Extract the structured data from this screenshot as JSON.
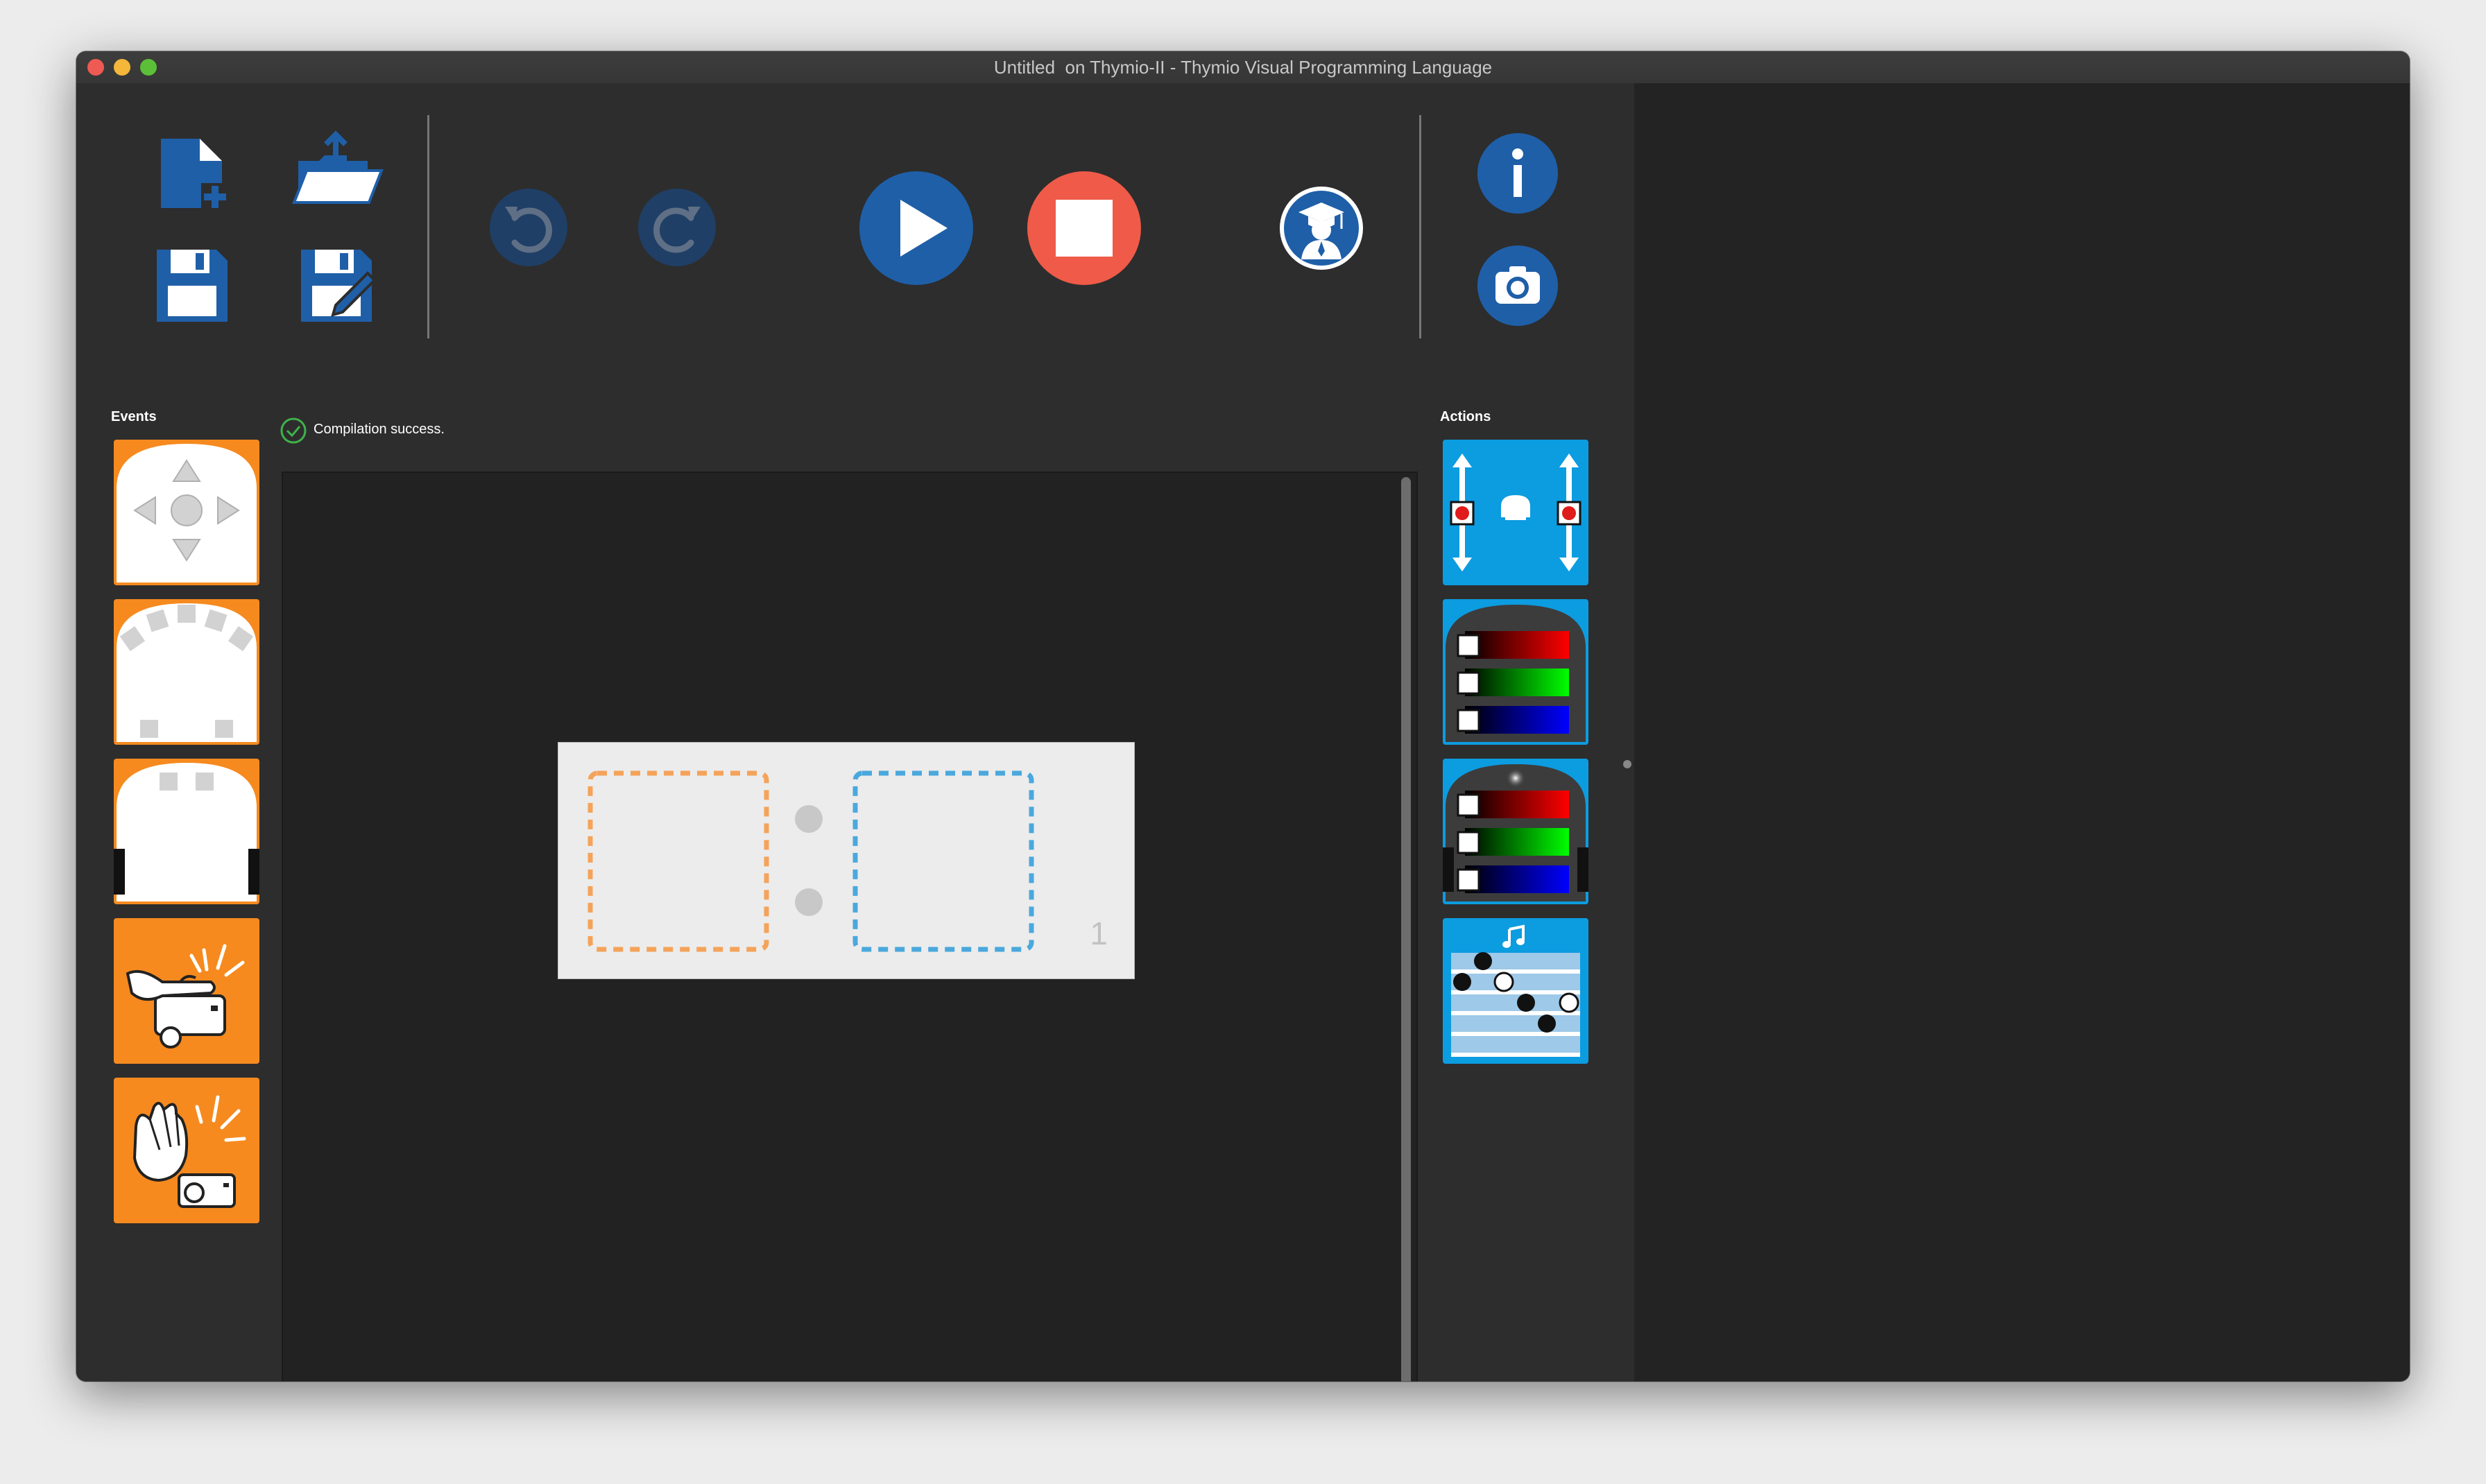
{
  "window": {
    "title": "Untitled  on Thymio-II - Thymio Visual Programming Language",
    "traffic_lights": {
      "close": "#ee5b52",
      "minimize": "#f4b73a",
      "zoom": "#5bc038"
    }
  },
  "toolbar": {
    "buttons": [
      {
        "name": "new-button",
        "icon": "new-file-icon"
      },
      {
        "name": "open-button",
        "icon": "open-folder-icon"
      },
      {
        "name": "save-button",
        "icon": "floppy-disk-icon"
      },
      {
        "name": "save-as-button",
        "icon": "floppy-disk-edit-icon"
      },
      {
        "name": "undo-button",
        "icon": "undo-icon"
      },
      {
        "name": "redo-button",
        "icon": "redo-icon"
      },
      {
        "name": "run-button",
        "icon": "play-icon"
      },
      {
        "name": "stop-button",
        "icon": "stop-icon"
      },
      {
        "name": "advanced-mode-button",
        "icon": "graduate-icon"
      },
      {
        "name": "help-button",
        "icon": "info-icon"
      },
      {
        "name": "screenshot-button",
        "icon": "camera-icon"
      }
    ],
    "colors": {
      "primary": "#1f5fa8",
      "stop": "#ef5b48",
      "disabled": "#1f3f66"
    }
  },
  "events": {
    "label": "Events",
    "tiles": [
      {
        "name": "event-buttons",
        "icon": "arrow-buttons-icon",
        "color": "#f68a1f"
      },
      {
        "name": "event-front-proximity",
        "icon": "front-proximity-icon",
        "color": "#f68a1f"
      },
      {
        "name": "event-ground-sensors",
        "icon": "ground-sensors-icon",
        "color": "#f68a1f"
      },
      {
        "name": "event-tap",
        "icon": "tap-robot-icon",
        "color": "#f68a1f"
      },
      {
        "name": "event-clap",
        "icon": "clap-icon",
        "color": "#f68a1f"
      }
    ]
  },
  "actions": {
    "label": "Actions",
    "tiles": [
      {
        "name": "action-motors",
        "icon": "motors-icon",
        "color": "#0c9ce0"
      },
      {
        "name": "action-top-color",
        "icon": "top-color-icon",
        "color": "#0c9ce0"
      },
      {
        "name": "action-bottom-color",
        "icon": "bottom-color-icon",
        "color": "#0c9ce0"
      },
      {
        "name": "action-music",
        "icon": "music-icon",
        "color": "#0c9ce0"
      }
    ]
  },
  "status": {
    "text": "Compilation success.",
    "icon": "check-circle-icon",
    "color": "#3fb24a"
  },
  "program": {
    "rows": [
      {
        "number": "1",
        "event_slot_color": "#f5a35a",
        "action_slot_color": "#4aa8dd"
      }
    ]
  }
}
